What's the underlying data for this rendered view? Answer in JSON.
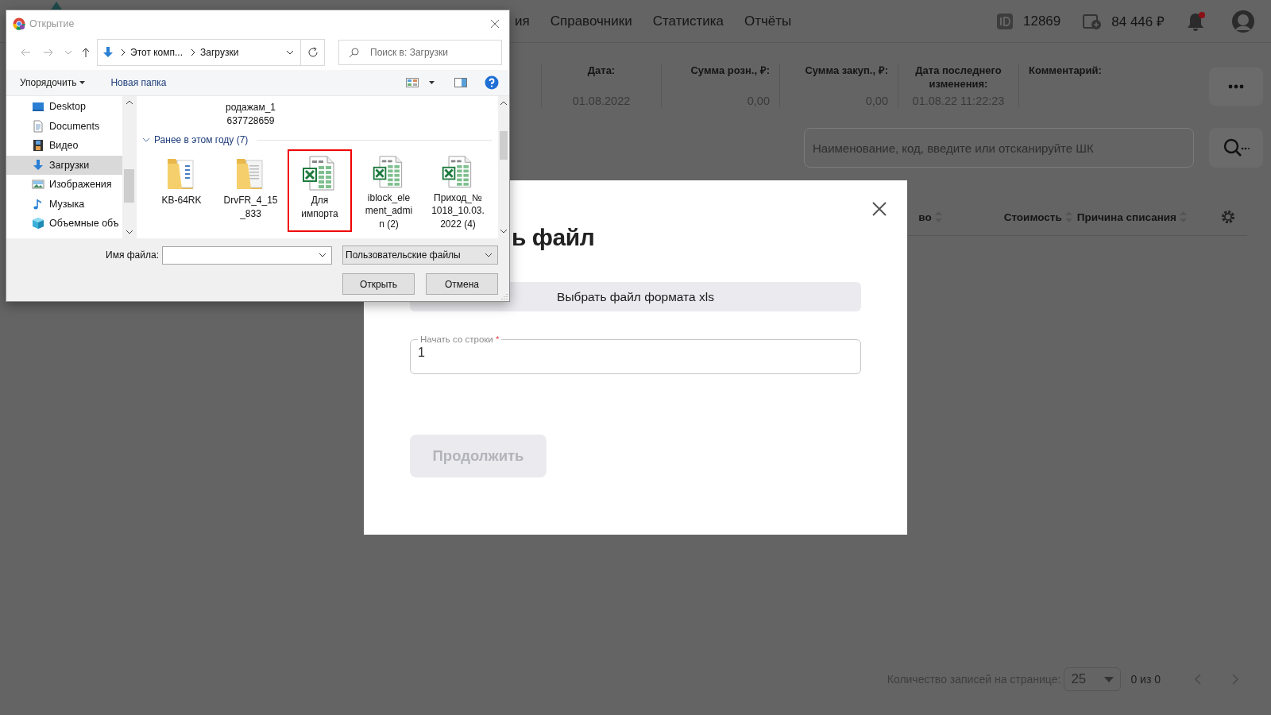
{
  "header": {
    "nav": [
      {
        "label": "ия"
      },
      {
        "label": "Справочники"
      },
      {
        "label": "Статистика"
      },
      {
        "label": "Отчёты"
      }
    ],
    "user_id": "12869",
    "balance": "84 446 ₽",
    "has_unread": true
  },
  "info": [
    {
      "label": "Дата:",
      "value": "01.08.2022"
    },
    {
      "label": "Сумма розн., ₽:",
      "value": "0,00"
    },
    {
      "label": "Сумма закуп., ₽:",
      "value": "0,00"
    },
    {
      "label": "Дата последнего изменения:",
      "value": "01.08.22 11:22:23"
    },
    {
      "label": "Комментарий:"
    }
  ],
  "search": {
    "placeholder": "Наименование, код, введите или отсканируйте ШК"
  },
  "table": {
    "columns": [
      "во",
      "Стоимость",
      "Причина списания"
    ]
  },
  "pager": {
    "label": "Количество записей на странице:",
    "page_size": "25",
    "range": "0 из 0"
  },
  "modal": {
    "title": "ь файл",
    "choose_button": "Выбрать файл формата xls",
    "start_row": {
      "label": "Начать со строки",
      "required_mark": "*",
      "value": "1"
    },
    "continue_button": {
      "label": "Продолжить",
      "disabled": true
    }
  },
  "file_dialog": {
    "title": "Открытие",
    "path": [
      "Этот комп...",
      "Загрузки"
    ],
    "search_placeholder": "Поиск в: Загрузки",
    "organize": "Упорядочить",
    "new_folder": "Новая папка",
    "nav": [
      {
        "label": "Desktop",
        "kind": "desktop",
        "selected": false
      },
      {
        "label": "Documents",
        "kind": "documents",
        "selected": false
      },
      {
        "label": "Видео",
        "kind": "video",
        "selected": false
      },
      {
        "label": "Загрузки",
        "kind": "downloads",
        "selected": true
      },
      {
        "label": "Изображения",
        "kind": "pictures",
        "selected": false
      },
      {
        "label": "Музыка",
        "kind": "music",
        "selected": false
      },
      {
        "label": "Объемные объ",
        "kind": "objects",
        "selected": false
      }
    ],
    "scrolled_item": {
      "lines": [
        "родажам_1",
        "637728659"
      ]
    },
    "group": {
      "label": "Ранее в этом году (7)",
      "expanded": true
    },
    "files": [
      {
        "kind": "folder",
        "lines": [
          "KB-64RK"
        ],
        "highlighted": false
      },
      {
        "kind": "folder-docs",
        "lines": [
          "DrvFR_4_15",
          "_833"
        ],
        "highlighted": false
      },
      {
        "kind": "excel",
        "lines": [
          "Для",
          "импорта"
        ],
        "highlighted": true
      },
      {
        "kind": "excel",
        "lines": [
          "iblock_ele",
          "ment_admi",
          "n (2)"
        ],
        "highlighted": false
      },
      {
        "kind": "excel",
        "lines": [
          "Приход_№",
          "1018_10.03.",
          "2022 (4)"
        ],
        "highlighted": false
      }
    ],
    "filename_label": "Имя файла:",
    "filter": "Пользовательские файлы",
    "buttons": [
      "Открыть",
      "Отмена"
    ]
  }
}
